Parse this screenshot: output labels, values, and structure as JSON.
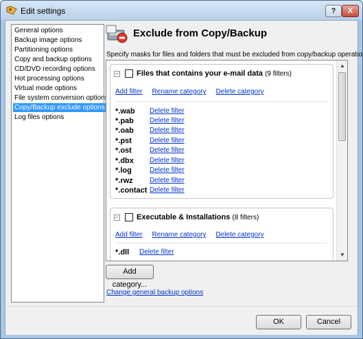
{
  "window": {
    "title": "Edit settings",
    "help_label": "?",
    "close_label": "X"
  },
  "sidebar": {
    "items": [
      {
        "label": "General options",
        "selected": false
      },
      {
        "label": "Backup image options",
        "selected": false
      },
      {
        "label": "Partitioning options",
        "selected": false
      },
      {
        "label": "Copy and backup options",
        "selected": false
      },
      {
        "label": "CD/DVD recording options",
        "selected": false
      },
      {
        "label": "Hot processing options",
        "selected": false
      },
      {
        "label": "Virtual mode options",
        "selected": false
      },
      {
        "label": "File system conversion options",
        "selected": false
      },
      {
        "label": "Copy/Backup exclude options",
        "selected": true
      },
      {
        "label": "Log files options",
        "selected": false
      }
    ]
  },
  "main": {
    "title": "Exclude from Copy/Backup",
    "description": "Specify masks for files and folders that must be excluded from copy/backup operations:",
    "groups": [
      {
        "toggle": "−",
        "title": "Files that contains your e-mail data",
        "count": "(9 filters)",
        "checked": false,
        "add_filter": "Add filter",
        "rename_category": "Rename category",
        "delete_category": "Delete category",
        "filters": [
          {
            "mask": "*.wab",
            "delete": "Delete filter"
          },
          {
            "mask": "*.pab",
            "delete": "Delete filter"
          },
          {
            "mask": "*.oab",
            "delete": "Delete filter"
          },
          {
            "mask": "*.pst",
            "delete": "Delete filter"
          },
          {
            "mask": "*.ost",
            "delete": "Delete filter"
          },
          {
            "mask": "*.dbx",
            "delete": "Delete filter"
          },
          {
            "mask": "*.log",
            "delete": "Delete filter"
          },
          {
            "mask": "*.rwz",
            "delete": "Delete filter"
          },
          {
            "mask": "*.contact",
            "delete": "Delete filter"
          }
        ]
      },
      {
        "toggle": "−",
        "title": "Executable & Installations",
        "count": "(8 filters)",
        "checked": false,
        "add_filter": "Add filter",
        "rename_category": "Rename category",
        "delete_category": "Delete category",
        "filters": [
          {
            "mask": "*.dll",
            "delete": "Delete filter"
          }
        ]
      }
    ],
    "scroll_up": "▲",
    "scroll_down": "▼",
    "add_category_label": "Add category...",
    "change_general_link": "Change general backup options"
  },
  "footer": {
    "ok_label": "OK",
    "cancel_label": "Cancel"
  },
  "colors": {
    "selection": "#3399ff",
    "link": "#0033cc",
    "title_bar": "#b9d1ea"
  }
}
